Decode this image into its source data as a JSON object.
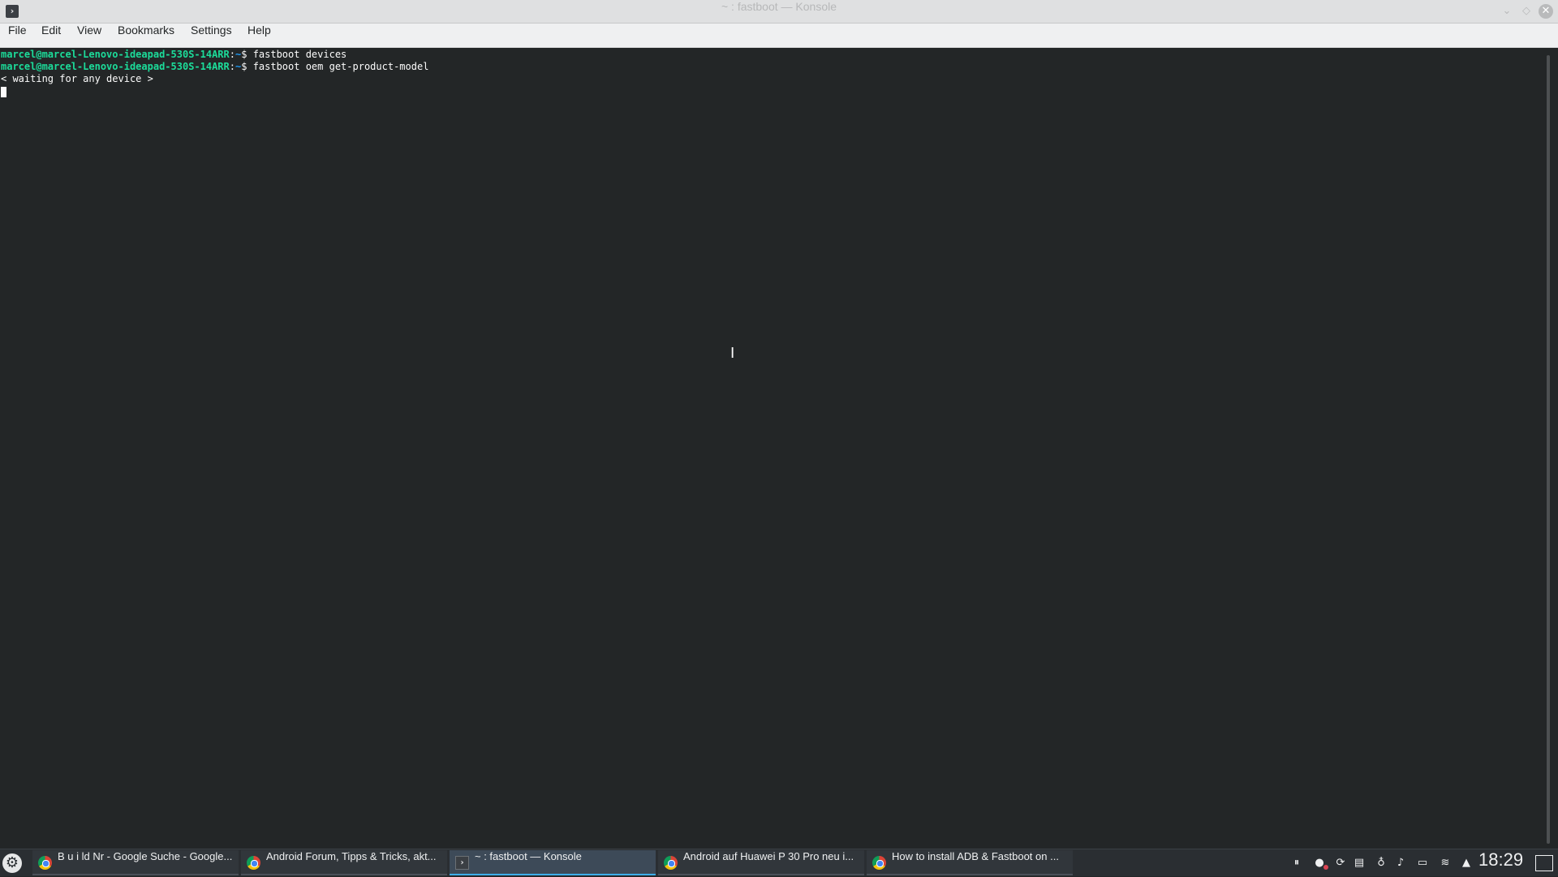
{
  "window": {
    "title": "~ : fastboot — Konsole",
    "app_icon": "terminal-icon",
    "controls": {
      "minimize_icon": "chevron-down-icon",
      "maximize_icon": "diamond-icon",
      "close_icon": "close-icon"
    }
  },
  "menubar": {
    "items": [
      {
        "label": "File"
      },
      {
        "label": "Edit"
      },
      {
        "label": "View"
      },
      {
        "label": "Bookmarks"
      },
      {
        "label": "Settings"
      },
      {
        "label": "Help"
      }
    ]
  },
  "terminal": {
    "lines": [
      {
        "user_host": "marcel@marcel-Lenovo-ideapad-530S-14ARR",
        "separator": ":",
        "path": "~",
        "prompt": "$ ",
        "command": "fastboot devices"
      },
      {
        "user_host": "marcel@marcel-Lenovo-ideapad-530S-14ARR",
        "separator": ":",
        "path": "~",
        "prompt": "$ ",
        "command": "fastboot oem get-product-model"
      },
      {
        "output": "< waiting for any device >"
      }
    ],
    "colors": {
      "background": "#232627",
      "user_host": "#1cdc9a",
      "path": "#1d99f3",
      "text": "#fcfcfc"
    }
  },
  "taskbar": {
    "launcher_icon": "app-launcher-icon",
    "tasks": [
      {
        "label": "B u i ld Nr - Google Suche - Google...",
        "icon": "chrome-icon",
        "active": false
      },
      {
        "label": "Android Forum, Tipps & Tricks, akt...",
        "icon": "chrome-icon",
        "active": false
      },
      {
        "label": "~ : fastboot — Konsole",
        "icon": "konsole-icon",
        "active": true
      },
      {
        "label": "Android auf Huawei P 30 Pro neu i...",
        "icon": "chrome-icon",
        "active": false
      },
      {
        "label": "How to install ADB & Fastboot on ...",
        "icon": "chrome-icon",
        "active": false
      }
    ],
    "tray": [
      "media-pause-icon",
      "notes-icon",
      "update-icon",
      "clipboard-icon",
      "bulb-icon",
      "volume-icon",
      "battery-icon",
      "wifi-icon",
      "expand-arrow-icon"
    ],
    "clock": "18:29",
    "accent": "#3daee9"
  }
}
